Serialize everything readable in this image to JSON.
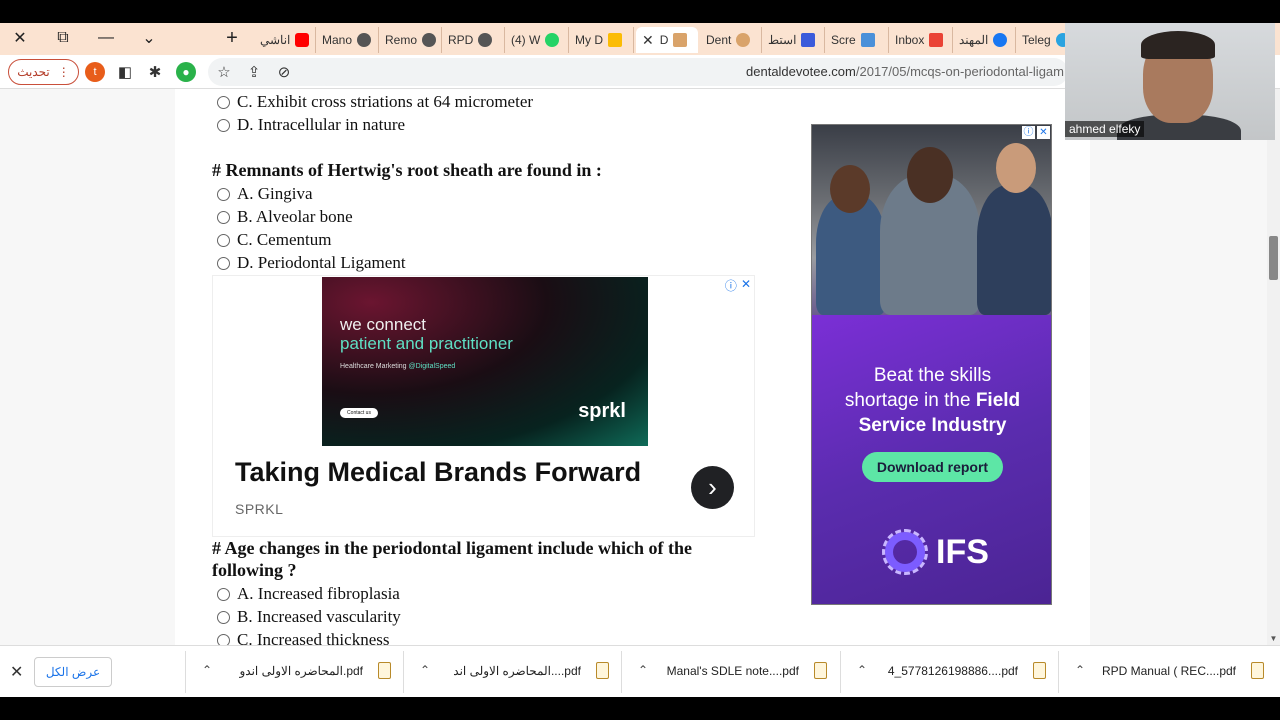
{
  "browser": {
    "tabs": [
      {
        "label": "اناشي",
        "icon": "youtube-icon",
        "color": "#ff0000"
      },
      {
        "label": "Mano",
        "icon": "globe-icon",
        "color": "#555555"
      },
      {
        "label": "Remo",
        "icon": "globe-icon",
        "color": "#555555"
      },
      {
        "label": "RPD",
        "icon": "globe-icon",
        "color": "#555555"
      },
      {
        "label": "(4) W",
        "icon": "whatsapp-icon",
        "color": "#25d366"
      },
      {
        "label": "My D",
        "icon": "drive-icon",
        "color": "#fbbc04"
      },
      {
        "label": "D",
        "icon": "site-icon",
        "color": "#d9a36a"
      },
      {
        "label": "Dent",
        "icon": "site-icon",
        "color": "#d9a36a"
      },
      {
        "label": "استط",
        "icon": "bookmark-icon",
        "color": "#3b5bdb"
      },
      {
        "label": "Scre",
        "icon": "screen-icon",
        "color": "#4a90d9"
      },
      {
        "label": "Inbox",
        "icon": "gmail-icon",
        "color": "#ea4335"
      },
      {
        "label": "المهند",
        "icon": "facebook-icon",
        "color": "#1877f2"
      },
      {
        "label": "Teleg",
        "icon": "telegram-icon",
        "color": "#2aa3e0"
      }
    ],
    "update_label": "تحديث",
    "profile_initial": "t",
    "url_domain": "dentaldevotee.com",
    "url_path": "/2017/05/mcqs-on-periodontal-ligam"
  },
  "page": {
    "prev_options": [
      "C. Exhibit cross striations at 64 micrometer",
      "D. Intracellular in nature"
    ],
    "q1": {
      "title": "# Remnants of Hertwig's root sheath are found in :",
      "options": [
        "A. Gingiva",
        "B. Alveolar bone",
        "C. Cementum",
        "D. Periodontal Ligament"
      ]
    },
    "q2": {
      "title_line1": "# Age changes in the periodontal ligament include which of the",
      "title_line2": "following ?",
      "options": [
        "A. Increased fibroplasia",
        "B. Increased vascularity",
        "C. Increased thickness"
      ]
    }
  },
  "ad_inline": {
    "line1": "we connect",
    "line2": "patient and practitioner",
    "line3": "Healthcare Marketing",
    "line3_handle": "@DigitalSpeed",
    "cta": "Contact us",
    "brand": "sprkl",
    "headline": "Taking Medical Brands Forward",
    "advertiser": "SPRKL"
  },
  "ad_side": {
    "copy_line1": "Beat the skills",
    "copy_line2a": "shortage in the ",
    "copy_line2b": "Field",
    "copy_line3": "Service Industry",
    "button": "Download report",
    "logo": "IFS"
  },
  "webcam": {
    "name": "ahmed elfeky"
  },
  "downloads": {
    "show_all": "عرض الكل",
    "items": [
      "المحاضره الاولى اندو.pdf",
      "المحاضره الاولى اند....pdf",
      "Manal's SDLE note....pdf",
      "4_5778126198886....pdf",
      "RPD Manual ( REC....pdf"
    ]
  }
}
